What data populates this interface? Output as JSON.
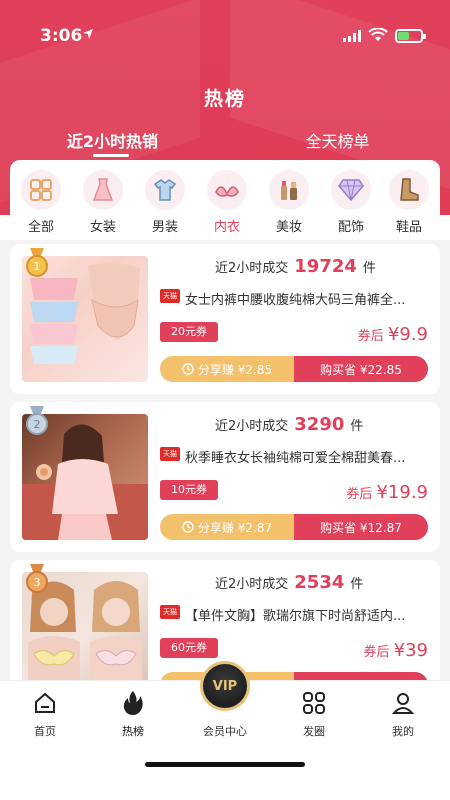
{
  "status": {
    "time": "3:06"
  },
  "header": {
    "title": "热榜",
    "tabs": [
      {
        "label": "近2小时热销"
      },
      {
        "label": "全天榜单"
      }
    ]
  },
  "categories": [
    {
      "label": "全部",
      "icon": "grid-icon"
    },
    {
      "label": "女装",
      "icon": "dress-icon"
    },
    {
      "label": "男装",
      "icon": "shirt-icon"
    },
    {
      "label": "内衣",
      "icon": "bra-icon",
      "active": true
    },
    {
      "label": "美妆",
      "icon": "makeup-icon"
    },
    {
      "label": "配饰",
      "icon": "diamond-icon"
    },
    {
      "label": "鞋品",
      "icon": "boot-icon"
    }
  ],
  "products": [
    {
      "rank": "1",
      "sales_prefix": "近2小时成交",
      "sales_count": "19724",
      "sales_suffix": "件",
      "shop_badge": "天猫",
      "title": "女士内裤中腰收腹纯棉大码三角裤全...",
      "coupon": "20元券",
      "after_label": "券后",
      "price": "¥9.9",
      "share": "分享赚 ¥2.85",
      "buy": "购买省 ¥22.85"
    },
    {
      "rank": "2",
      "sales_prefix": "近2小时成交",
      "sales_count": "3290",
      "sales_suffix": "件",
      "shop_badge": "天猫",
      "title": "秋季睡衣女长袖纯棉可爱全棉甜美春...",
      "coupon": "10元券",
      "after_label": "券后",
      "price": "¥19.9",
      "share": "分享赚 ¥2.87",
      "buy": "购买省 ¥12.87"
    },
    {
      "rank": "3",
      "sales_prefix": "近2小时成交",
      "sales_count": "2534",
      "sales_suffix": "件",
      "shop_badge": "天猫",
      "title": "【单件文胸】歌瑞尔旗下时尚舒适内...",
      "coupon": "60元券",
      "after_label": "券后",
      "price": "¥39",
      "share": "",
      "buy": ""
    }
  ],
  "nav": [
    {
      "label": "首页",
      "icon": "home-icon"
    },
    {
      "label": "热榜",
      "icon": "flame-icon",
      "active": true
    },
    {
      "label": "会员中心",
      "icon": "vip-icon",
      "badge": "VIP"
    },
    {
      "label": "发圈",
      "icon": "apps-icon"
    },
    {
      "label": "我的",
      "icon": "user-icon"
    }
  ],
  "colors": {
    "accent": "#e0405a",
    "share": "#f3c06b",
    "vip_gold": "#e7c27a"
  }
}
